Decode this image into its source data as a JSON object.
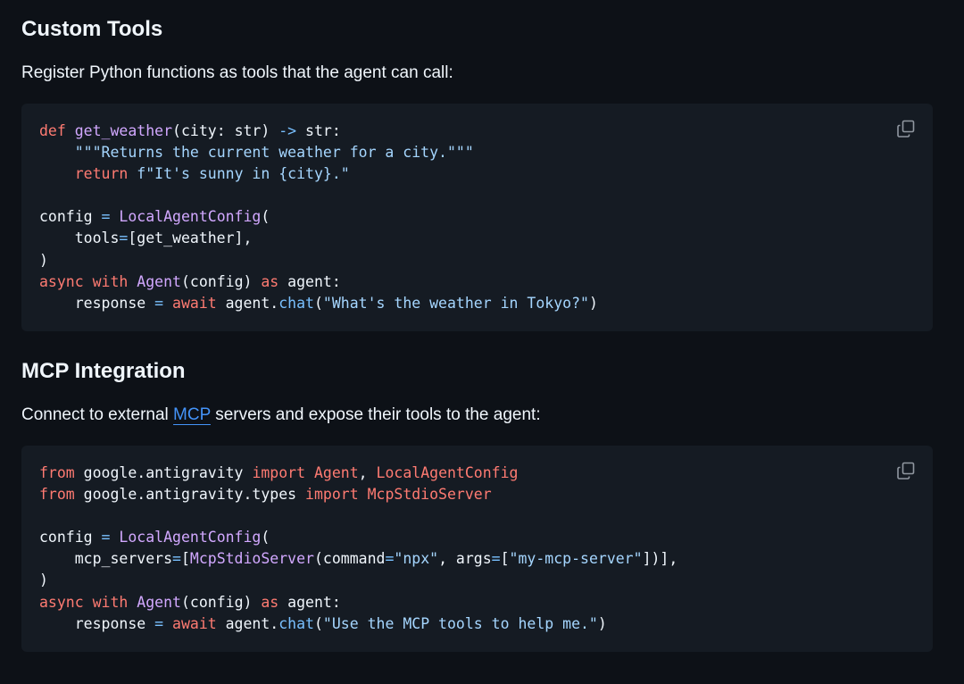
{
  "sections": [
    {
      "heading": "Custom Tools",
      "intro": "Register Python functions as tools that the agent can call:",
      "code": [
        [
          {
            "t": "def",
            "c": "k"
          },
          {
            "t": " "
          },
          {
            "t": "get_weather",
            "c": "f"
          },
          {
            "t": "(city: str) "
          },
          {
            "t": "->",
            "c": "o"
          },
          {
            "t": " str:"
          }
        ],
        [
          {
            "t": "    "
          },
          {
            "t": "\"\"\"Returns the current weather for a city.\"\"\"",
            "c": "s"
          }
        ],
        [
          {
            "t": "    "
          },
          {
            "t": "return",
            "c": "k"
          },
          {
            "t": " "
          },
          {
            "t": "f\"It's sunny in {city}.\"",
            "c": "s"
          }
        ],
        [],
        [
          {
            "t": "config "
          },
          {
            "t": "=",
            "c": "o"
          },
          {
            "t": " "
          },
          {
            "t": "LocalAgentConfig",
            "c": "f"
          },
          {
            "t": "("
          }
        ],
        [
          {
            "t": "    tools"
          },
          {
            "t": "=",
            "c": "o"
          },
          {
            "t": "[get_weather],"
          }
        ],
        [
          {
            "t": ")"
          }
        ],
        [
          {
            "t": "async",
            "c": "k"
          },
          {
            "t": " "
          },
          {
            "t": "with",
            "c": "k"
          },
          {
            "t": " "
          },
          {
            "t": "Agent",
            "c": "f"
          },
          {
            "t": "(config) "
          },
          {
            "t": "as",
            "c": "k"
          },
          {
            "t": " agent:"
          }
        ],
        [
          {
            "t": "    response "
          },
          {
            "t": "=",
            "c": "o"
          },
          {
            "t": " "
          },
          {
            "t": "await",
            "c": "k"
          },
          {
            "t": " agent."
          },
          {
            "t": "chat",
            "c": "o"
          },
          {
            "t": "("
          },
          {
            "t": "\"What's the weather in Tokyo?\"",
            "c": "s"
          },
          {
            "t": ")"
          }
        ]
      ]
    },
    {
      "heading": "MCP Integration",
      "intro_before": "Connect to external ",
      "intro_link": "MCP",
      "intro_after": " servers and expose their tools to the agent:",
      "code": [
        [
          {
            "t": "from",
            "c": "k"
          },
          {
            "t": " google.antigravity "
          },
          {
            "t": "import",
            "c": "k"
          },
          {
            "t": " "
          },
          {
            "t": "Agent",
            "c": "k"
          },
          {
            "t": ", "
          },
          {
            "t": "LocalAgentConfig",
            "c": "k"
          }
        ],
        [
          {
            "t": "from",
            "c": "k"
          },
          {
            "t": " google.antigravity.types "
          },
          {
            "t": "import",
            "c": "k"
          },
          {
            "t": " "
          },
          {
            "t": "McpStdioServer",
            "c": "k"
          }
        ],
        [],
        [
          {
            "t": "config "
          },
          {
            "t": "=",
            "c": "o"
          },
          {
            "t": " "
          },
          {
            "t": "LocalAgentConfig",
            "c": "f"
          },
          {
            "t": "("
          }
        ],
        [
          {
            "t": "    mcp_servers"
          },
          {
            "t": "=",
            "c": "o"
          },
          {
            "t": "["
          },
          {
            "t": "McpStdioServer",
            "c": "f"
          },
          {
            "t": "(command"
          },
          {
            "t": "=",
            "c": "o"
          },
          {
            "t": "\"npx\"",
            "c": "s"
          },
          {
            "t": ", args"
          },
          {
            "t": "=",
            "c": "o"
          },
          {
            "t": "["
          },
          {
            "t": "\"my-mcp-server\"",
            "c": "s"
          },
          {
            "t": "])],"
          }
        ],
        [
          {
            "t": ")"
          }
        ],
        [
          {
            "t": "async",
            "c": "k"
          },
          {
            "t": " "
          },
          {
            "t": "with",
            "c": "k"
          },
          {
            "t": " "
          },
          {
            "t": "Agent",
            "c": "f"
          },
          {
            "t": "(config) "
          },
          {
            "t": "as",
            "c": "k"
          },
          {
            "t": " agent:"
          }
        ],
        [
          {
            "t": "    response "
          },
          {
            "t": "=",
            "c": "o"
          },
          {
            "t": " "
          },
          {
            "t": "await",
            "c": "k"
          },
          {
            "t": " agent."
          },
          {
            "t": "chat",
            "c": "o"
          },
          {
            "t": "("
          },
          {
            "t": "\"Use the MCP tools to help me.\"",
            "c": "s"
          },
          {
            "t": ")"
          }
        ]
      ]
    }
  ],
  "icons": {
    "copy": "copy-icon"
  },
  "colors": {
    "page_background": "#0d1117",
    "code_background": "#151b23",
    "keyword": "#ff7b72",
    "function": "#d2a8ff",
    "string": "#a5d6ff",
    "operator": "#79c0ff",
    "link": "#4493f8"
  }
}
